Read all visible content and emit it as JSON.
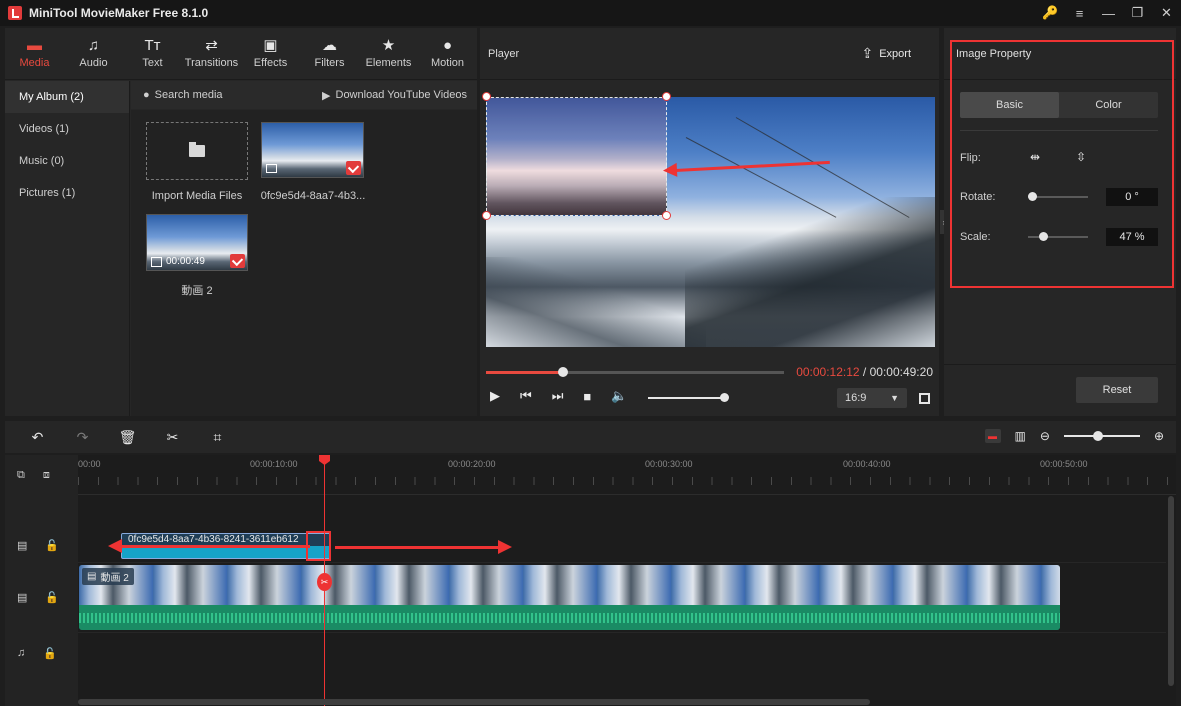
{
  "app": {
    "title": "MiniTool MovieMaker Free 8.1.0"
  },
  "window_controls": [
    "🔑",
    "≡",
    "—",
    "❐",
    "✕"
  ],
  "tabs": [
    {
      "label": "Media",
      "icon": "folder-icon",
      "glyph": "▬"
    },
    {
      "label": "Audio",
      "icon": "music-icon",
      "glyph": "♫"
    },
    {
      "label": "Text",
      "icon": "text-icon",
      "glyph": "Tт"
    },
    {
      "label": "Transitions",
      "icon": "transitions-icon",
      "glyph": "⇄"
    },
    {
      "label": "Effects",
      "icon": "effects-icon",
      "glyph": "▣"
    },
    {
      "label": "Filters",
      "icon": "filters-icon",
      "glyph": "☁"
    },
    {
      "label": "Elements",
      "icon": "elements-icon",
      "glyph": "★"
    },
    {
      "label": "Motion",
      "icon": "motion-icon",
      "glyph": "●"
    }
  ],
  "sidebar": {
    "items": [
      {
        "label": "My Album (2)"
      },
      {
        "label": "Videos (1)"
      },
      {
        "label": "Music (0)"
      },
      {
        "label": "Pictures (1)"
      }
    ]
  },
  "media": {
    "search_label": "Search media",
    "download_label": "Download YouTube Videos",
    "import_label": "Import Media Files",
    "items": [
      {
        "label": "0fc9e5d4-8aa7-4b3..."
      },
      {
        "label": "動画 2",
        "duration": "00:00:49"
      }
    ]
  },
  "player": {
    "title": "Player",
    "export_label": "Export",
    "current_time": "00:00:12:12",
    "total_time": " / 00:00:49:20",
    "progress": 0.26,
    "volume": 1.0,
    "ratio": "16:9"
  },
  "props": {
    "title": "Image Property",
    "tab_basic": "Basic",
    "tab_color": "Color",
    "flip_label": "Flip:",
    "rotate_label": "Rotate:",
    "rotate_value": "0 °",
    "rotate_level": 0.0,
    "scale_label": "Scale:",
    "scale_value": "47 %",
    "scale_level": 0.18,
    "reset_label": "Reset"
  },
  "timeline": {
    "ticks": [
      "00:00",
      "00:00:10:00",
      "00:00:20:00",
      "00:00:30:00",
      "00:00:40:00",
      "00:00:50:00"
    ],
    "overlay_clip_name": "0fc9e5d4-8aa7-4b36-8241-3611eb612",
    "video_clip_name": "動画 2",
    "zoom_level": 0.45
  }
}
